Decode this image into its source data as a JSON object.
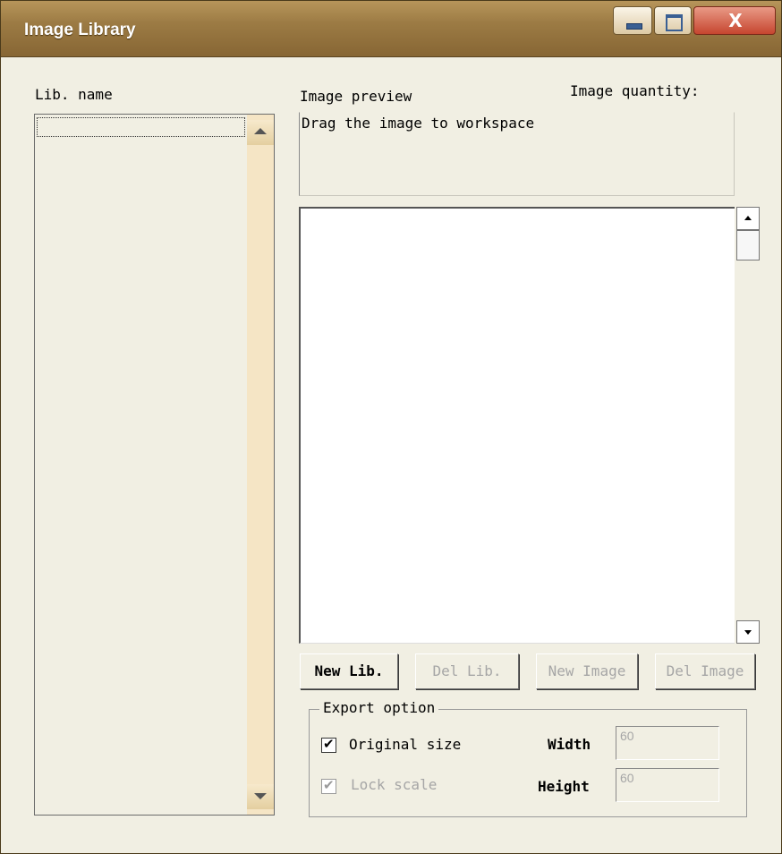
{
  "window": {
    "title": "Image Library",
    "close_glyph": "X"
  },
  "left": {
    "lib_name_label": "Lib. name"
  },
  "right": {
    "image_preview_label": "Image preview",
    "image_quantity_label": "Image quantity:",
    "hint_text": "Drag the image to workspace"
  },
  "buttons": {
    "new_lib": "New Lib.",
    "del_lib": "Del Lib.",
    "new_image": "New Image",
    "del_image": "Del Image"
  },
  "export": {
    "group_title": "Export option",
    "original_size_label": "Original size",
    "original_size_checked": true,
    "lock_scale_label": "Lock scale",
    "lock_scale_checked": true,
    "width_label": "Width",
    "width_value": "60",
    "height_label": "Height",
    "height_value": "60"
  },
  "icons": {
    "minimize": "minimize-icon",
    "maximize": "maximize-icon",
    "close": "close-icon",
    "check": "check-icon"
  }
}
